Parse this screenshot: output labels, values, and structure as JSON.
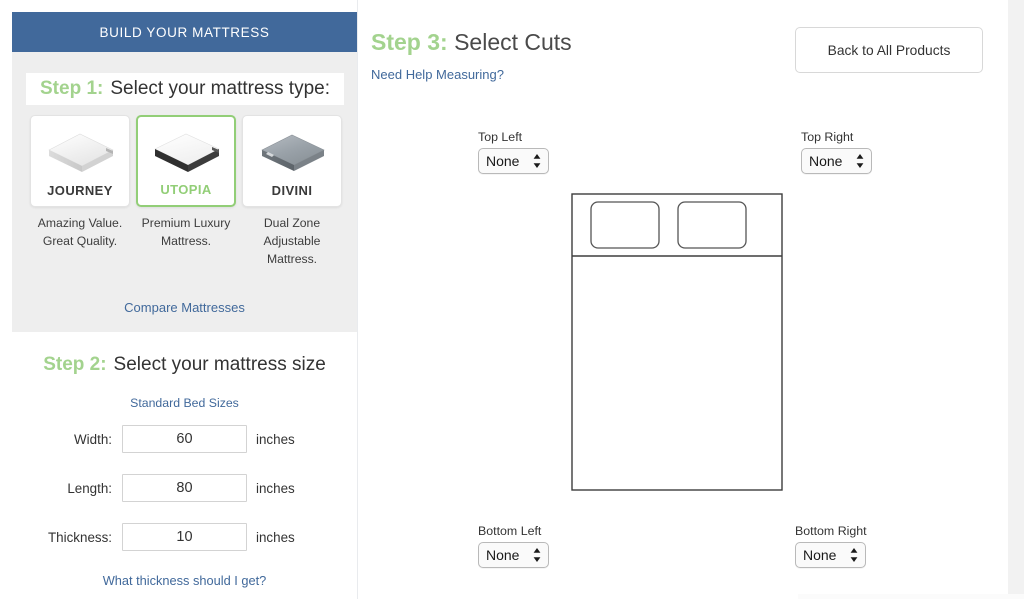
{
  "theme": {
    "brand_blue": "#41699b",
    "accent_green": "#a3d38e",
    "link_blue": "#41699b",
    "panel_gray": "#eeeeee"
  },
  "header": {
    "brand_bar_title": "BUILD YOUR MATTRESS"
  },
  "step1": {
    "step_number": "Step 1:",
    "step_text": "Select your mattress type:",
    "compare_link": "Compare Mattresses",
    "products": [
      {
        "name": "JOURNEY",
        "description": "Amazing Value. Great Quality.",
        "selected": false,
        "image": "journey-mattress-image"
      },
      {
        "name": "UTOPIA",
        "description": "Premium Luxury Mattress.",
        "selected": true,
        "image": "utopia-mattress-image"
      },
      {
        "name": "DIVINI",
        "description": "Dual Zone Adjustable Mattress.",
        "selected": false,
        "image": "divini-mattress-image"
      }
    ]
  },
  "step2": {
    "step_number": "Step 2:",
    "step_text": "Select your mattress size",
    "standard_sizes_link": "Standard Bed Sizes",
    "thickness_help_link": "What thickness should I get?",
    "fields": [
      {
        "label": "Width:",
        "value": "60",
        "unit": "inches",
        "placeholder": "Width"
      },
      {
        "label": "Length:",
        "value": "80",
        "unit": "inches",
        "placeholder": "Length"
      },
      {
        "label": "Thickness:",
        "value": "10",
        "unit": "inches",
        "placeholder": "Thickness"
      }
    ]
  },
  "step3": {
    "step_number": "Step 3:",
    "step_text": "Select Cuts",
    "help_link": "Need Help Measuring?",
    "back_button": "Back to All Products",
    "cuts": [
      {
        "label": "Top Left",
        "value": "None"
      },
      {
        "label": "Top Right",
        "value": "None"
      },
      {
        "label": "Bottom Left",
        "value": "None"
      },
      {
        "label": "Bottom Right",
        "value": "None"
      }
    ]
  }
}
